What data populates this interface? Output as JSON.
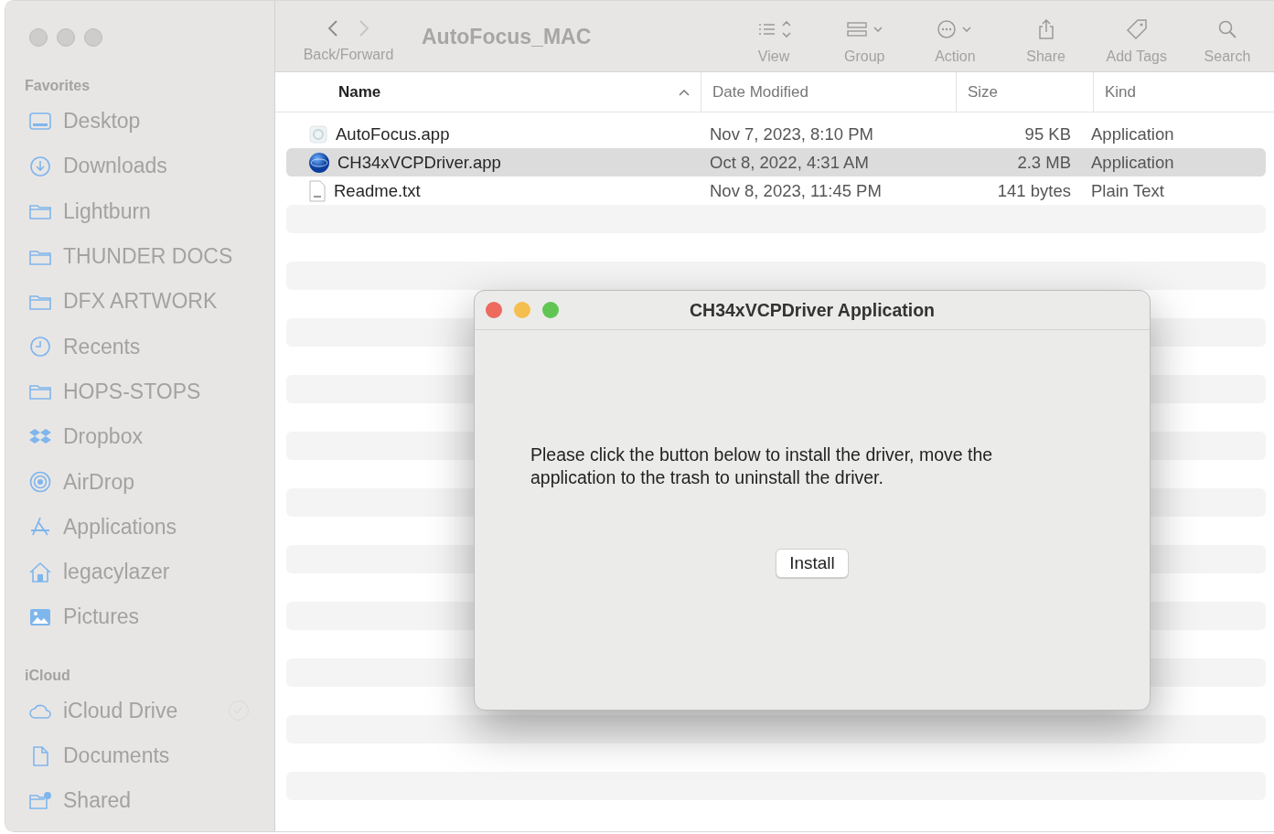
{
  "window": {
    "title": "AutoFocus_MAC"
  },
  "toolbar": {
    "nav_label": "Back/Forward",
    "items": [
      {
        "kind": "view",
        "label": "View"
      },
      {
        "kind": "group",
        "label": "Group"
      },
      {
        "kind": "action",
        "label": "Action"
      },
      {
        "kind": "share",
        "label": "Share"
      },
      {
        "kind": "tags",
        "label": "Add Tags"
      },
      {
        "kind": "search",
        "label": "Search"
      }
    ]
  },
  "sidebar": {
    "sections": [
      {
        "title": "Favorites",
        "items": [
          {
            "kind": "desktop",
            "label": "Desktop"
          },
          {
            "kind": "download",
            "label": "Downloads"
          },
          {
            "kind": "folder",
            "label": "Lightburn"
          },
          {
            "kind": "folder",
            "label": "THUNDER DOCS"
          },
          {
            "kind": "folder",
            "label": "DFX ARTWORK"
          },
          {
            "kind": "clock",
            "label": "Recents"
          },
          {
            "kind": "folder",
            "label": "HOPS-STOPS"
          },
          {
            "kind": "dropbox",
            "label": "Dropbox"
          },
          {
            "kind": "airdrop",
            "label": "AirDrop"
          },
          {
            "kind": "apps",
            "label": "Applications"
          },
          {
            "kind": "home",
            "label": "legacylazer"
          },
          {
            "kind": "pictures",
            "label": "Pictures"
          }
        ]
      },
      {
        "title": "iCloud",
        "items": [
          {
            "kind": "cloud",
            "label": "iCloud Drive"
          },
          {
            "kind": "document",
            "label": "Documents"
          },
          {
            "kind": "shared",
            "label": "Shared"
          }
        ]
      }
    ]
  },
  "table": {
    "columns": [
      {
        "label": "Name",
        "sorted": true
      },
      {
        "label": "Date Modified",
        "sorted": false
      },
      {
        "label": "Size",
        "sorted": false
      },
      {
        "label": "Kind",
        "sorted": false
      }
    ],
    "rows": [
      {
        "kind": "app",
        "name": "AutoFocus.app",
        "date": "Nov 7, 2023, 8:10 PM",
        "size": "95 KB",
        "type": "Application",
        "selected": false
      },
      {
        "kind": "driver",
        "name": "CH34xVCPDriver.app",
        "date": "Oct 8, 2022, 4:31 AM",
        "size": "2.3 MB",
        "type": "Application",
        "selected": true
      },
      {
        "kind": "text",
        "name": "Readme.txt",
        "date": "Nov 8, 2023, 11:45 PM",
        "size": "141 bytes",
        "type": "Plain Text",
        "selected": false
      }
    ]
  },
  "dialog": {
    "title": "CH34xVCPDriver Application",
    "message": "Please click the button below to install the driver, move the application to the trash to uninstall the driver.",
    "button": "Install"
  }
}
